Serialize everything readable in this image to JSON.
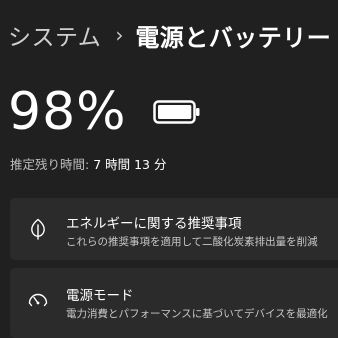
{
  "breadcrumb": {
    "parent": "システム",
    "separator": "›",
    "current": "電源とバッテリー"
  },
  "battery": {
    "percent_text": "98%",
    "level": 0.98,
    "remaining_label": "推定残り時間:",
    "remaining_value": "7 時間 13 分"
  },
  "cards": [
    {
      "title": "エネルギーに関する推奨事項",
      "subtitle": "これらの推奨事項を適用して二酸化炭素排出量を削減",
      "icon": "leaf-icon"
    },
    {
      "title": "電源モード",
      "subtitle": "電力消費とパフォーマンスに基づいてデバイスを最適化",
      "icon": "power-mode-gauge-icon"
    }
  ],
  "colors": {
    "background": "#202020",
    "card": "#2b2b2b",
    "text": "#ffffff",
    "secondary_text": "#c8c8c8"
  }
}
